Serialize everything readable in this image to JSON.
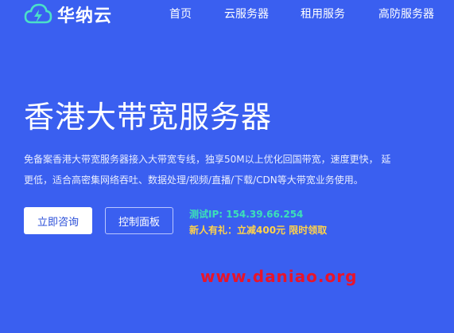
{
  "brand": {
    "name": "华纳云"
  },
  "nav": {
    "items": [
      {
        "label": "首页"
      },
      {
        "label": "云服务器"
      },
      {
        "label": "租用服务"
      },
      {
        "label": "高防服务器"
      }
    ]
  },
  "hero": {
    "title": "香港大带宽服务器",
    "desc_line1": "免备案香港大带宽服务器接入大带宽专线，独享50M以上优化回国带宽，速度更快， 延",
    "desc_line2": "更低，适合高密集网络吞吐、数据处理/视频/直播/下载/CDN等大带宽业务使用。"
  },
  "buttons": {
    "consult": "立即咨询",
    "panel": "控制面板"
  },
  "promo": {
    "test_ip": "测试IP: 154.39.66.254",
    "gift": "新人有礼：立减400元 限时领取"
  },
  "watermark": "www.daniao.org",
  "colors": {
    "background": "#3a5ff0",
    "accent_green": "#3ce0b8",
    "accent_yellow": "#ffd24a",
    "watermark_red": "#e8142a"
  },
  "icons": {
    "logo": "cloud-lightning-icon"
  }
}
